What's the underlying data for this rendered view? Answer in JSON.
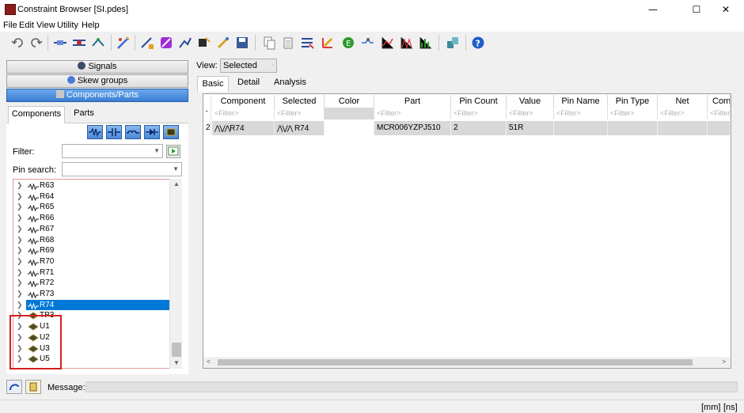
{
  "window": {
    "title": "Constraint Browser [SI.pdes]",
    "minimize": "—",
    "maximize": "☐",
    "close": "✕"
  },
  "menu": [
    "File",
    "Edit",
    "View",
    "Utility",
    "Help"
  ],
  "toolbar_icons": [
    "undo-icon",
    "redo-icon",
    "net-icon",
    "diff-pair-icon",
    "topology-icon",
    "wizard-icon",
    "rule-icon",
    "rule-group-icon",
    "rule-set-icon",
    "constraint-edit-icon",
    "constraint-apply-icon",
    "save-icon",
    "copy-icon",
    "paste-icon",
    "filter-icon",
    "layer-icon",
    "export-icon",
    "route-icon",
    "graph-icon",
    "waveform-icon",
    "spectrum-icon",
    "manager-icon",
    "help-icon"
  ],
  "left": {
    "sections": [
      "Signals",
      "Skew groups",
      "Components/Parts"
    ],
    "tabs": [
      "Components",
      "Parts"
    ],
    "filter_label": "Filter:",
    "pin_search_label": "Pin search:",
    "tree": [
      {
        "label": "R63",
        "type": "resistor"
      },
      {
        "label": "R64",
        "type": "resistor"
      },
      {
        "label": "R65",
        "type": "resistor"
      },
      {
        "label": "R66",
        "type": "resistor"
      },
      {
        "label": "R67",
        "type": "resistor"
      },
      {
        "label": "R68",
        "type": "resistor"
      },
      {
        "label": "R69",
        "type": "resistor"
      },
      {
        "label": "R70",
        "type": "resistor"
      },
      {
        "label": "R71",
        "type": "resistor"
      },
      {
        "label": "R72",
        "type": "resistor"
      },
      {
        "label": "R73",
        "type": "resistor"
      },
      {
        "label": "R74",
        "type": "resistor",
        "selected": true
      },
      {
        "label": "TP3",
        "type": "ic"
      },
      {
        "label": "U1",
        "type": "ic"
      },
      {
        "label": "U2",
        "type": "ic"
      },
      {
        "label": "U3",
        "type": "ic"
      },
      {
        "label": "U5",
        "type": "ic"
      }
    ]
  },
  "right": {
    "view_label": "View:",
    "view_value": "Selected",
    "tabs": [
      "Basic",
      "Detail",
      "Analysis"
    ],
    "columns": [
      "Component",
      "Selected",
      "Color",
      "Part",
      "Pin Count",
      "Value",
      "Pin Name",
      "Pin Type",
      "Net",
      "Comm"
    ],
    "filter_placeholder": "<Filter>",
    "rows": [
      {
        "num": "2",
        "component": "R74",
        "selected": "R74",
        "color": "",
        "part": "MCR006YZPJ510",
        "pin_count": "2",
        "value": "51R",
        "pin_name": "",
        "pin_type": "",
        "net": "",
        "comm": ""
      }
    ]
  },
  "status": {
    "message_label": "Message:",
    "units_mm": "[mm]",
    "units_ns": "[ns]"
  }
}
